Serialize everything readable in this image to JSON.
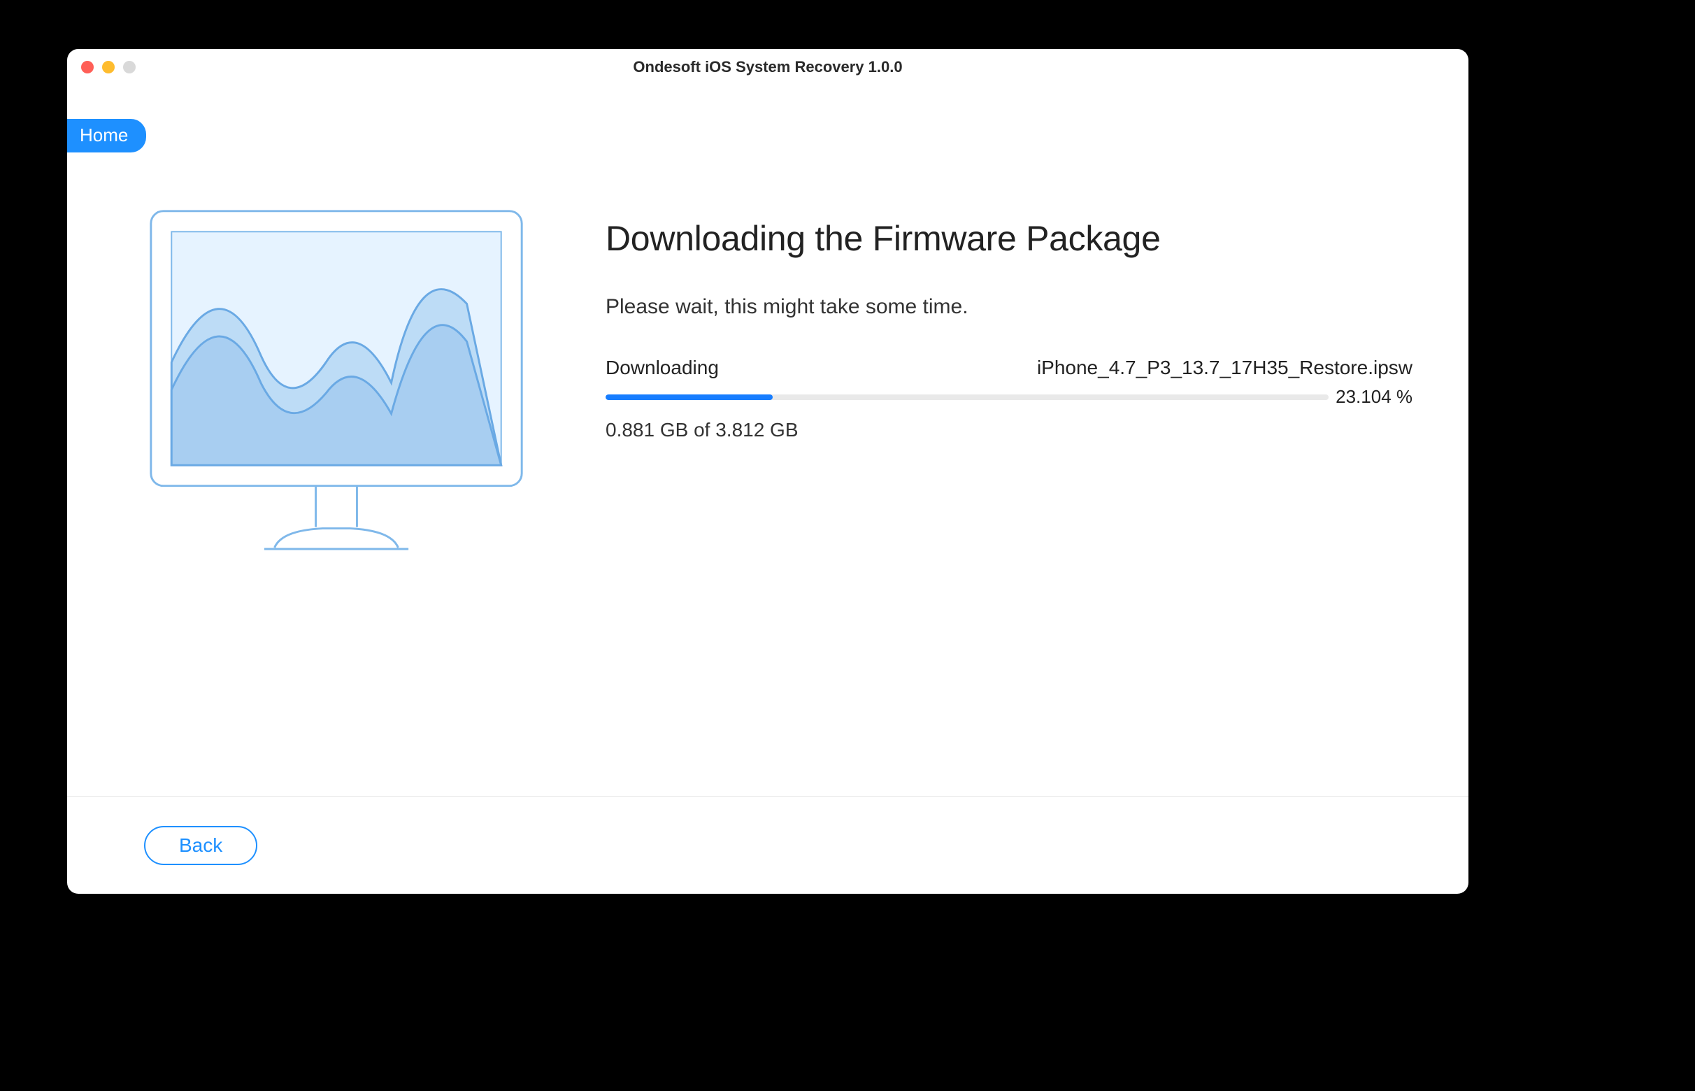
{
  "window": {
    "title": "Ondesoft iOS System Recovery 1.0.0",
    "homeLabel": "Home"
  },
  "main": {
    "heading": "Downloading the Firmware Package",
    "subtext": "Please wait, this might take some time.",
    "statusLabel": "Downloading",
    "fileName": "iPhone_4.7_P3_13.7_17H35_Restore.ipsw",
    "progressPercent": 23.104,
    "progressPercentLabel": "23.104 %",
    "sizeDone": "0.881 GB",
    "sizeTotal": "3.812 GB",
    "sizeLine": "0.881 GB of 3.812 GB"
  },
  "footer": {
    "backLabel": "Back"
  },
  "colors": {
    "accent": "#1e90ff",
    "progress": "#177dff"
  }
}
